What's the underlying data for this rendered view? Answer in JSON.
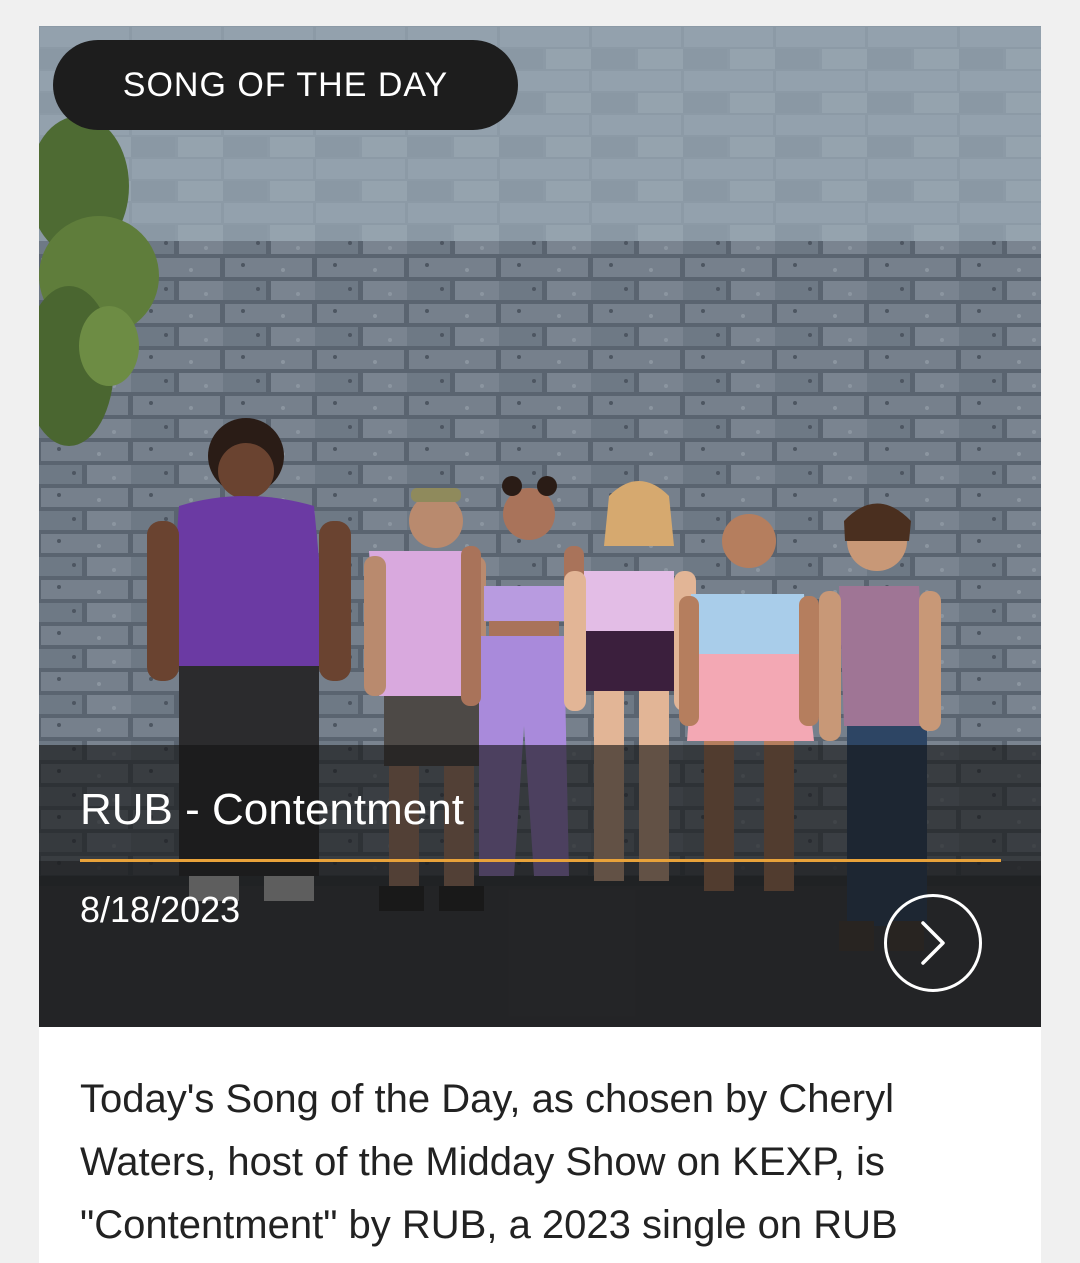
{
  "badge": {
    "label": "SONG OF THE DAY"
  },
  "song": {
    "title": "RUB - Contentment",
    "date": "8/18/2023"
  },
  "icons": {
    "next": "chevron-right-icon"
  },
  "description": {
    "text": "Today's Song of the Day, as chosen by Cheryl Waters, host of the Midday Show on KEXP, is \"Contentment\" by RUB, a 2023 single on RUB"
  },
  "colors": {
    "accent": "#e8a23a",
    "badge_bg": "#1d1d1d",
    "page_bg": "#f0f0f0"
  }
}
